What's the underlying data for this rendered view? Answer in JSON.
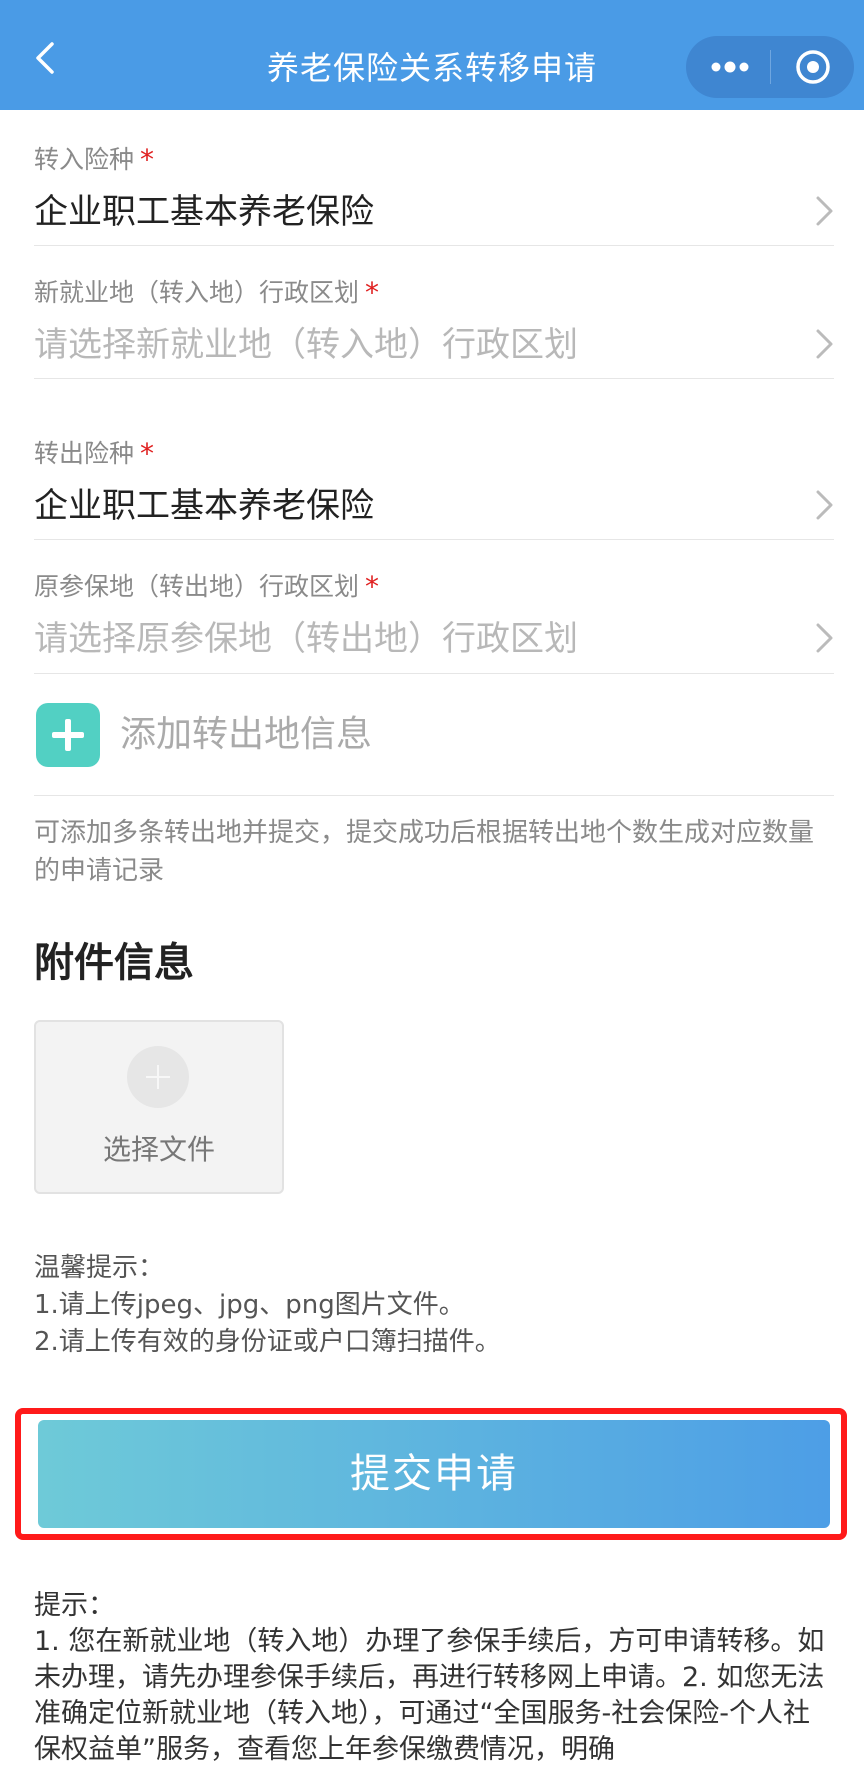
{
  "navbar": {
    "title": "养老保险关系转移申请"
  },
  "form": {
    "fields": [
      {
        "label": "转入险种",
        "required": "*",
        "value": "企业职工基本养老保险",
        "is_placeholder": false
      },
      {
        "label": "新就业地（转入地）行政区划",
        "required": "*",
        "value": "请选择新就业地（转入地）行政区划",
        "is_placeholder": true
      },
      {
        "label": "转出险种",
        "required": "*",
        "value": "企业职工基本养老保险",
        "is_placeholder": false
      },
      {
        "label": "原参保地（转出地）行政区划",
        "required": "*",
        "value": "请选择原参保地（转出地）行政区划",
        "is_placeholder": true
      }
    ],
    "add_label": "添加转出地信息",
    "note": "可添加多条转出地并提交，提交成功后根据转出地个数生成对应数量的申请记录"
  },
  "attachments": {
    "title": "附件信息",
    "upload_label": "选择文件"
  },
  "tips": {
    "heading": "温馨提示：",
    "line1": "1.请上传jpeg、jpg、png图片文件。",
    "line2": "2.请上传有效的身份证或户口簿扫描件。"
  },
  "submit_label": "提交申请",
  "bottom_tips": {
    "heading": "提示：",
    "text": "1. 您在新就业地（转入地）办理了参保手续后，方可申请转移。如未办理，请先办理参保手续后，再进行转移网上申请。2. 如您无法准确定位新就业地（转入地），可通过“全国服务-社会保险-个人社保权益单”服务，查看您上年参保缴费情况，明确"
  },
  "colors": {
    "navbar": "#4a9be6",
    "required": "#e02020",
    "add_icon": "#52d0c3",
    "highlight_frame": "#ff1a1a"
  }
}
